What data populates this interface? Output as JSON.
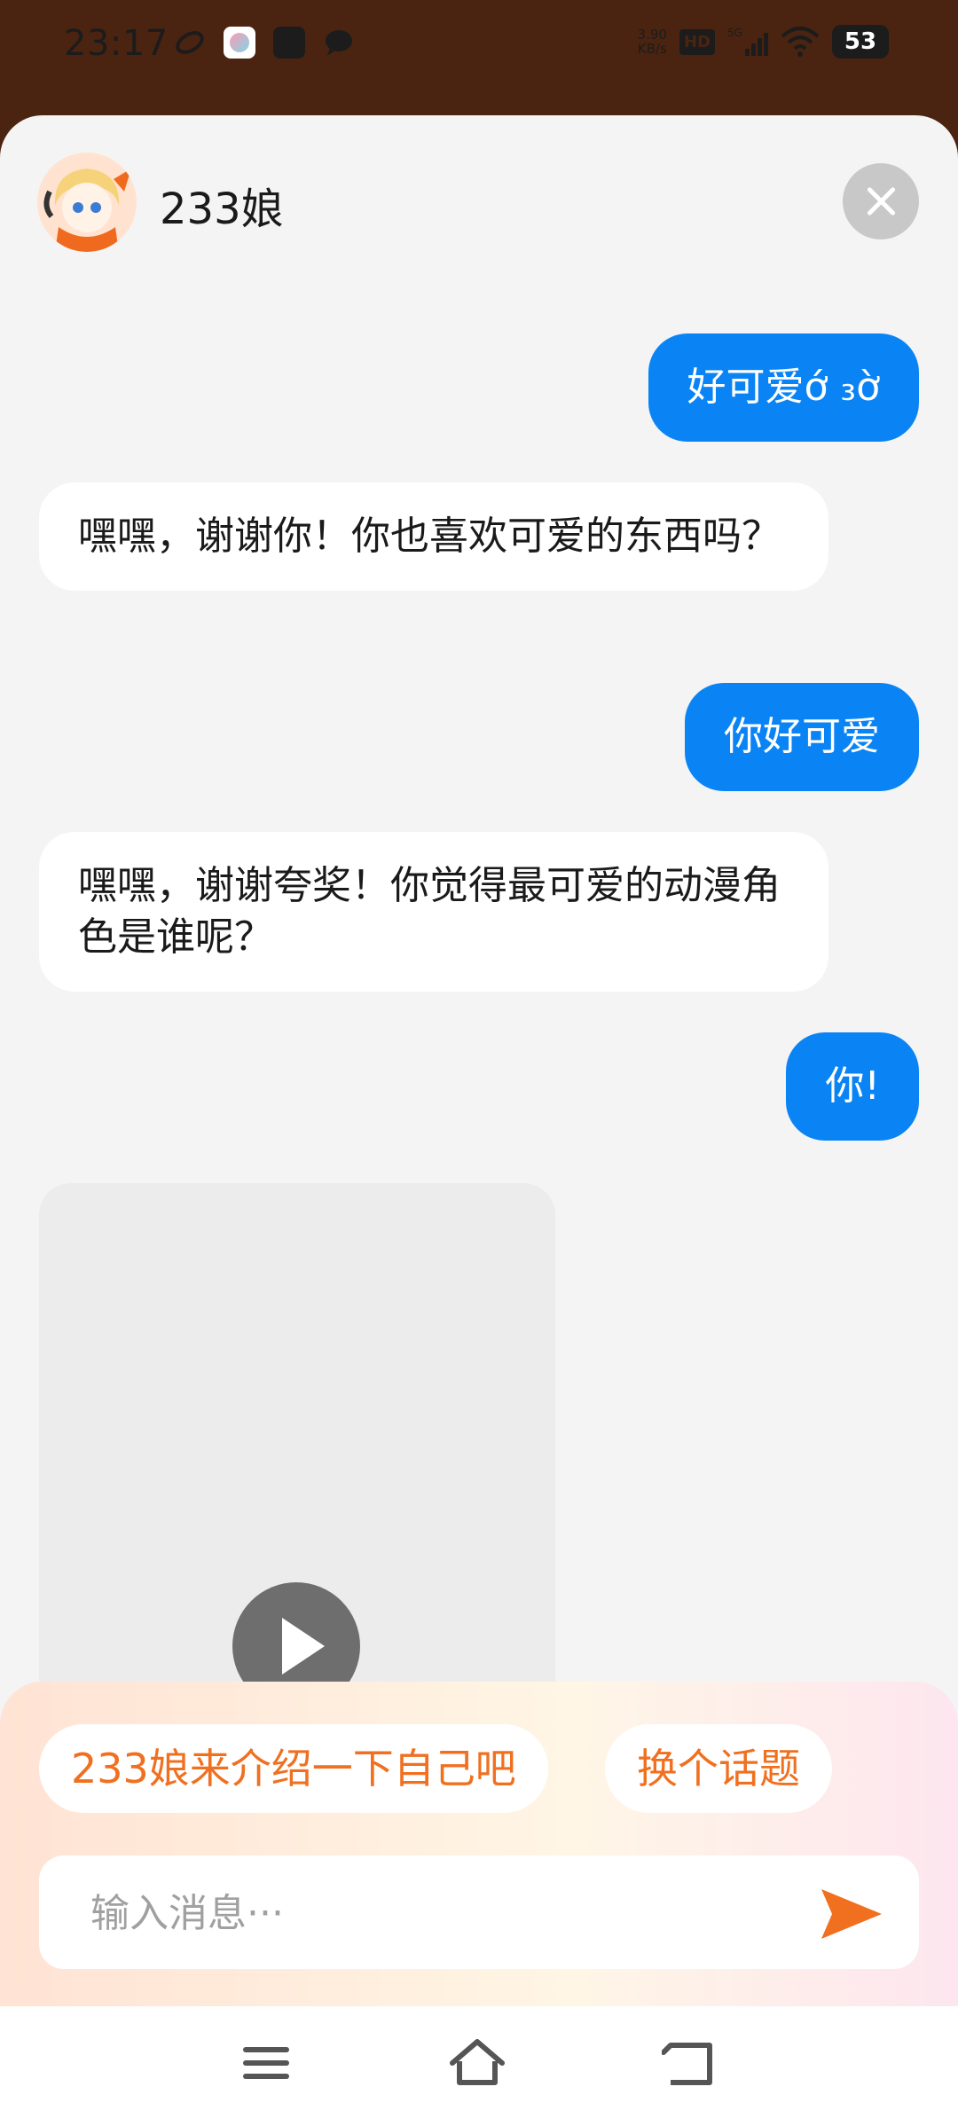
{
  "status_bar": {
    "time": "23:17",
    "net_speed_value": "3.90",
    "net_speed_unit": "KB/s",
    "hd_label": "HD",
    "network_label": "5G",
    "battery": "53",
    "icons": [
      "sync-icon",
      "app-icon",
      "shopping-bag-icon",
      "message-icon",
      "signal-icon",
      "wifi-icon"
    ]
  },
  "header": {
    "title": "233娘"
  },
  "messages": [
    {
      "role": "user",
      "text": "好可爱ớ ₃ờ"
    },
    {
      "role": "bot",
      "text": "嘿嘿，谢谢你！你也喜欢可爱的东西吗？"
    },
    {
      "role": "user",
      "text": "你好可爱"
    },
    {
      "role": "bot",
      "text": "嘿嘿，谢谢夸奖！你觉得最可爱的动漫角色是谁呢？"
    },
    {
      "role": "user",
      "text": "你!"
    }
  ],
  "suggestions": [
    "233娘来介绍一下自己吧",
    "换个话题"
  ],
  "input": {
    "placeholder": "输入消息···"
  },
  "colors": {
    "user_bubble": "#0a84f5",
    "suggestion_text": "#f07020",
    "send_icon": "#f07020"
  }
}
